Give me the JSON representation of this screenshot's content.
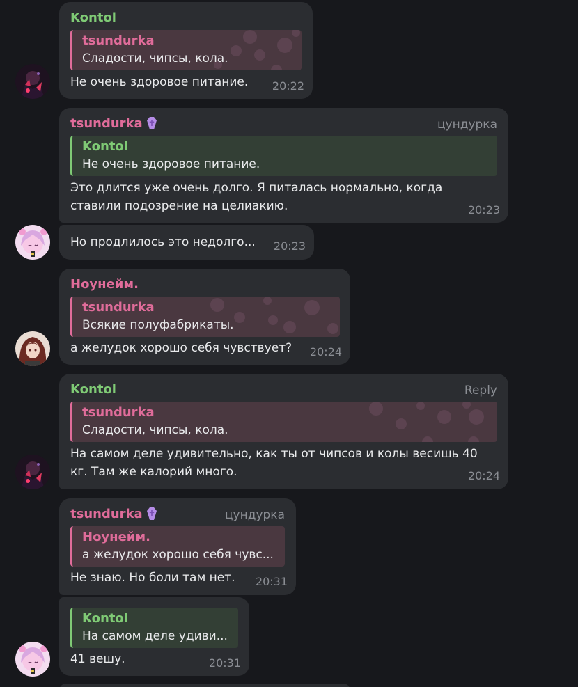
{
  "colors": {
    "background": "#17181c",
    "bubble": "#2b2d31",
    "green_name": "#7fca75",
    "pink_name": "#e06c9a",
    "time": "#8a8d93"
  },
  "messages": [
    {
      "sender": "Kontol",
      "reply": {
        "name": "tsundurka",
        "text": "Сладости, чипсы, кола."
      },
      "text": "Не очень здоровое питание.",
      "time": "20:22"
    },
    {
      "sender": "tsundurka",
      "sender_badge_icon": "coffin-icon",
      "tag": "цундурка",
      "reply": {
        "name": "Kontol",
        "text": "Не очень здоровое питание."
      },
      "text_lines": [
        "Это длится уже очень долго. Я питалась нормально, когда",
        "ставили подозрение на целиакию."
      ],
      "time": "20:23"
    },
    {
      "text": "Но продлилось это недолго...",
      "time": "20:23"
    },
    {
      "sender": "Ноунейм.",
      "reply": {
        "name": "tsundurka",
        "text": "Всякие полуфабрикаты."
      },
      "text": "а желудок хорошо себя чувствует?",
      "time": "20:24"
    },
    {
      "sender": "Kontol",
      "action": "Reply",
      "reply": {
        "name": "tsundurka",
        "text": "Сладости, чипсы, кола."
      },
      "text_lines": [
        "На самом деле удивительно, как ты от чипсов и колы весишь 40",
        "кг. Там же калорий много."
      ],
      "time": "20:24"
    },
    {
      "sender": "tsundurka",
      "sender_badge_icon": "coffin-icon",
      "tag": "цундурка",
      "reply": {
        "name": "Ноунейм.",
        "text": "а желудок хорошо себя чувс..."
      },
      "text": "Не знаю. Но боли там нет.",
      "time": "20:31"
    },
    {
      "reply": {
        "name": "Kontol",
        "text": "На самом деле удиви..."
      },
      "text": "41 вешу.",
      "time": "20:31"
    }
  ]
}
